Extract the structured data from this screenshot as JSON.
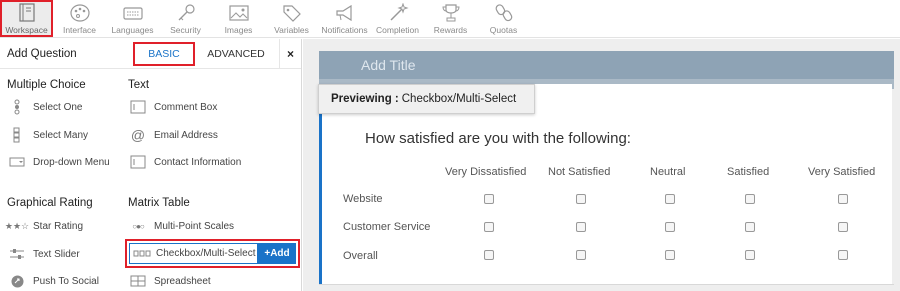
{
  "toolbar": {
    "items": [
      {
        "label": "Workspace",
        "icon": "workspace-icon",
        "active": true
      },
      {
        "label": "Interface",
        "icon": "palette-icon"
      },
      {
        "label": "Languages",
        "icon": "keyboard-icon"
      },
      {
        "label": "Security",
        "icon": "key-icon"
      },
      {
        "label": "Images",
        "icon": "image-icon"
      },
      {
        "label": "Variables",
        "icon": "tag-icon"
      },
      {
        "label": "Notifications",
        "icon": "megaphone-icon"
      },
      {
        "label": "Completion",
        "icon": "wand-icon"
      },
      {
        "label": "Rewards",
        "icon": "trophy-icon"
      },
      {
        "label": "Quotas",
        "icon": "link-icon"
      }
    ]
  },
  "panel": {
    "title": "Add Question",
    "tab_basic": "BASIC",
    "tab_advanced": "ADVANCED",
    "close": "×",
    "sections": {
      "multiple_choice": "Multiple Choice",
      "text": "Text",
      "graphical_rating": "Graphical Rating",
      "matrix_table": "Matrix Table"
    },
    "items": {
      "select_one": "Select One",
      "select_many": "Select Many",
      "dropdown_menu": "Drop-down Menu",
      "comment_box": "Comment Box",
      "email_address": "Email Address",
      "contact_information": "Contact Information",
      "star_rating": "Star Rating",
      "text_slider": "Text Slider",
      "push_to_social": "Push To Social",
      "multi_point_scales": "Multi-Point Scales",
      "checkbox_multi_select": "Checkbox/Multi-Select",
      "spreadsheet": "Spreadsheet"
    },
    "add_label": "+Add"
  },
  "preview": {
    "add_title": "Add Title",
    "previewing_label": "Previewing :",
    "previewing_value": "Checkbox/Multi-Select",
    "question": "How satisfied are you with the following:",
    "columns": [
      "Very Dissatisfied",
      "Not Satisfied",
      "Neutral",
      "Satisfied",
      "Very Satisfied"
    ],
    "rows": [
      "Website",
      "Customer Service",
      "Overall"
    ]
  },
  "colors": {
    "accent_blue": "#1a73c8",
    "highlight_red": "#e0202a",
    "title_bar": "#8ea3b5"
  }
}
